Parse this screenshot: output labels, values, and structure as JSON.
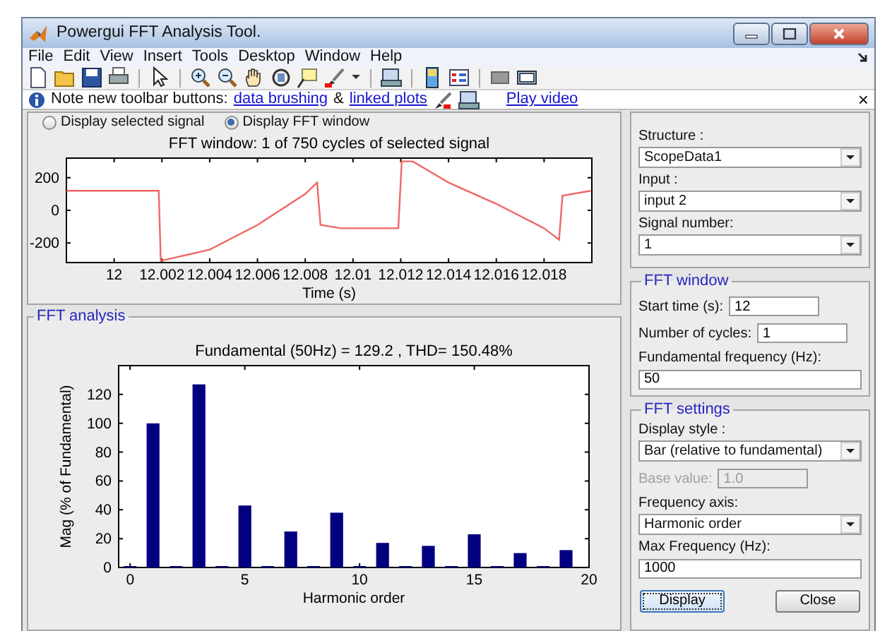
{
  "window": {
    "title": "Powergui FFT Analysis Tool."
  },
  "menu": [
    "File",
    "Edit",
    "View",
    "Insert",
    "Tools",
    "Desktop",
    "Window",
    "Help"
  ],
  "info_bar": {
    "text": "Note new toolbar buttons:",
    "links": [
      "data brushing",
      "linked plots"
    ],
    "joiner": "&",
    "video_link": "Play video",
    "close": "×"
  },
  "display_mode": [
    {
      "label": "Display selected signal",
      "selected": false
    },
    {
      "label": "Display FFT window",
      "selected": true
    }
  ],
  "signal_plot": {
    "chart_data": {
      "type": "line",
      "title": "FFT window: 1 of 750 cycles of selected signal",
      "xlabel": "Time (s)",
      "x": [
        11.998,
        12.00187,
        12.00195,
        12.004,
        12.006,
        12.008,
        12.0085,
        12.00864,
        12.0095,
        12.0119,
        12.01204,
        12.0125,
        12.014,
        12.016,
        12.018,
        12.01863,
        12.01877,
        12.01996
      ],
      "series": [
        {
          "color": "#f06666",
          "values": [
            120,
            120,
            -310,
            -240,
            -90,
            100,
            170,
            -90,
            -110,
            -110,
            300,
            300,
            170,
            40,
            -110,
            -180,
            90,
            120
          ]
        }
      ],
      "xlim": [
        11.998,
        12.02
      ],
      "ylim": [
        -320,
        320
      ],
      "xticks": [
        12,
        12.002,
        12.004,
        12.006,
        12.008,
        12.01,
        12.012,
        12.014,
        12.016,
        12.018
      ],
      "yticks": [
        -200,
        0,
        200
      ]
    }
  },
  "fft_analysis": {
    "title": "FFT analysis",
    "chart_data": {
      "type": "bar",
      "title": "Fundamental (50Hz) = 129.2 , THD= 150.48%",
      "xlabel": "Harmonic order",
      "ylabel": "Mag (% of Fundamental)",
      "x": [
        0,
        1,
        2,
        3,
        4,
        5,
        6,
        7,
        8,
        9,
        10,
        11,
        12,
        13,
        14,
        15,
        16,
        17,
        18,
        19
      ],
      "series": [
        {
          "color": "#000080",
          "values": [
            1,
            100,
            1,
            127,
            1,
            43,
            1,
            25,
            1,
            38,
            1,
            17,
            1,
            15,
            1,
            23,
            1,
            10,
            1,
            12
          ]
        }
      ],
      "xlim": [
        -0.5,
        20
      ],
      "ylim": [
        0,
        140
      ],
      "xticks": [
        0,
        5,
        10,
        15,
        20
      ],
      "yticks": [
        0,
        20,
        40,
        60,
        80,
        100,
        120
      ]
    }
  },
  "signal_selection": [
    {
      "label": "Structure :",
      "value": "ScopeData1",
      "kind": "dropdown"
    },
    {
      "label": "Input :",
      "value": "input 2",
      "kind": "dropdown"
    },
    {
      "label": "Signal number:",
      "value": "1",
      "kind": "dropdown"
    }
  ],
  "fft_window": {
    "title": "FFT window",
    "fields": [
      {
        "label": "Start time (s):",
        "value": "12",
        "kind": "inline"
      },
      {
        "label": "Number of cycles:",
        "value": "1",
        "kind": "inline"
      },
      {
        "label": "Fundamental frequency (Hz):",
        "value": "50",
        "kind": "text"
      }
    ]
  },
  "fft_settings": {
    "title": "FFT settings",
    "fields": [
      {
        "label": "Display style :",
        "value": "Bar (relative to fundamental)",
        "kind": "dropdown",
        "disabled": false
      },
      {
        "label": "Base value:",
        "value": "1.0",
        "kind": "inline",
        "disabled": true
      },
      {
        "label": "Frequency axis:",
        "value": "Harmonic order",
        "kind": "dropdown",
        "disabled": false
      },
      {
        "label": "Max Frequency (Hz):",
        "value": "1000",
        "kind": "text",
        "disabled": false
      }
    ]
  },
  "buttons": [
    {
      "label": "Display",
      "focused": true
    },
    {
      "label": "Close",
      "focused": false
    }
  ]
}
